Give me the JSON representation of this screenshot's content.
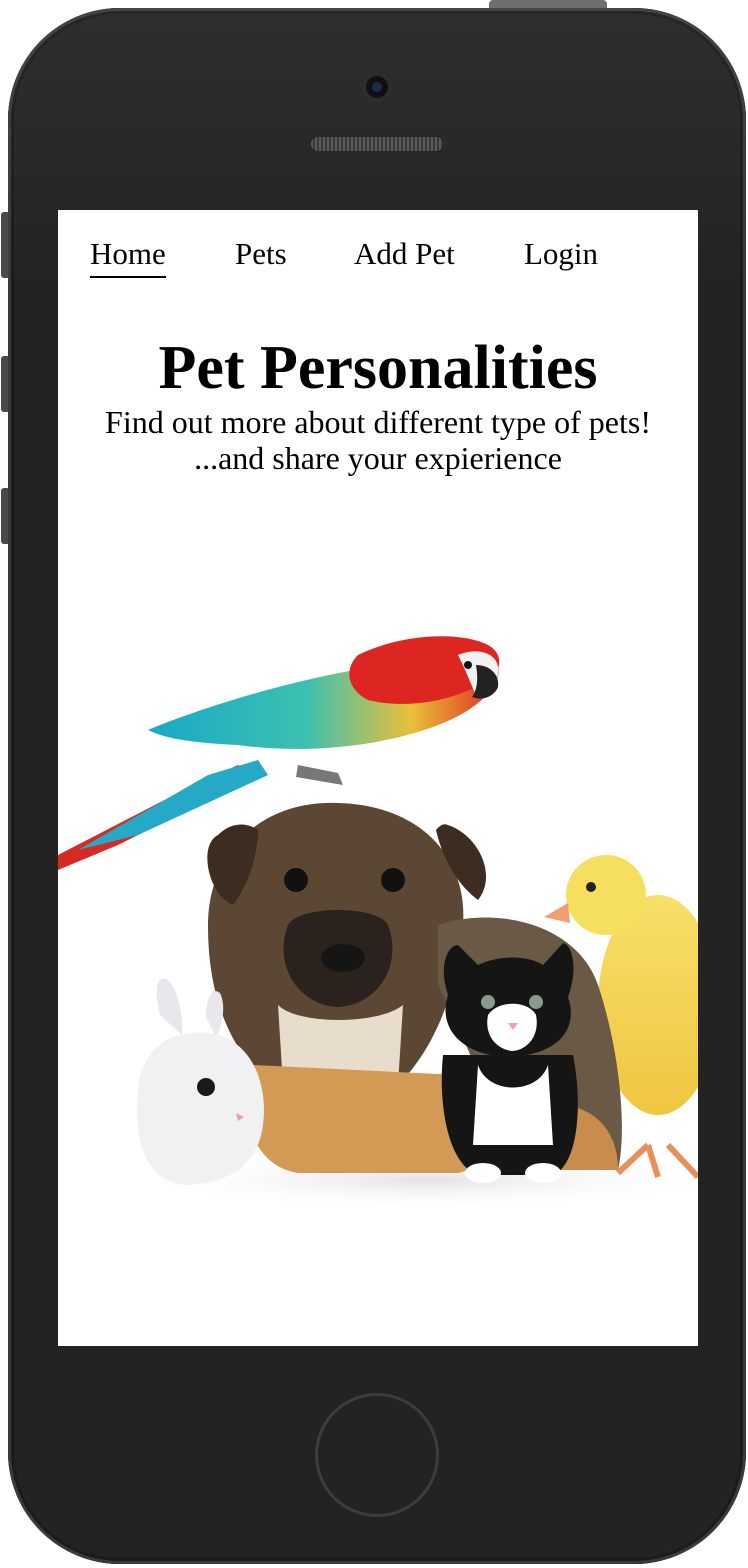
{
  "nav": {
    "items": [
      {
        "label": "Home",
        "active": true
      },
      {
        "label": "Pets",
        "active": false
      },
      {
        "label": "Add Pet",
        "active": false
      },
      {
        "label": "Login",
        "active": false
      }
    ]
  },
  "hero": {
    "title": "Pet Personalities",
    "tagline_line1": "Find out more about different type of pets!",
    "tagline_line2": "...and share your expierience"
  },
  "image": {
    "animals": [
      "parrot",
      "puppy",
      "rabbit",
      "kitten",
      "duckling"
    ]
  },
  "colors": {
    "phone_body": "#232323",
    "screen_bg": "#ffffff",
    "text": "#000000"
  }
}
